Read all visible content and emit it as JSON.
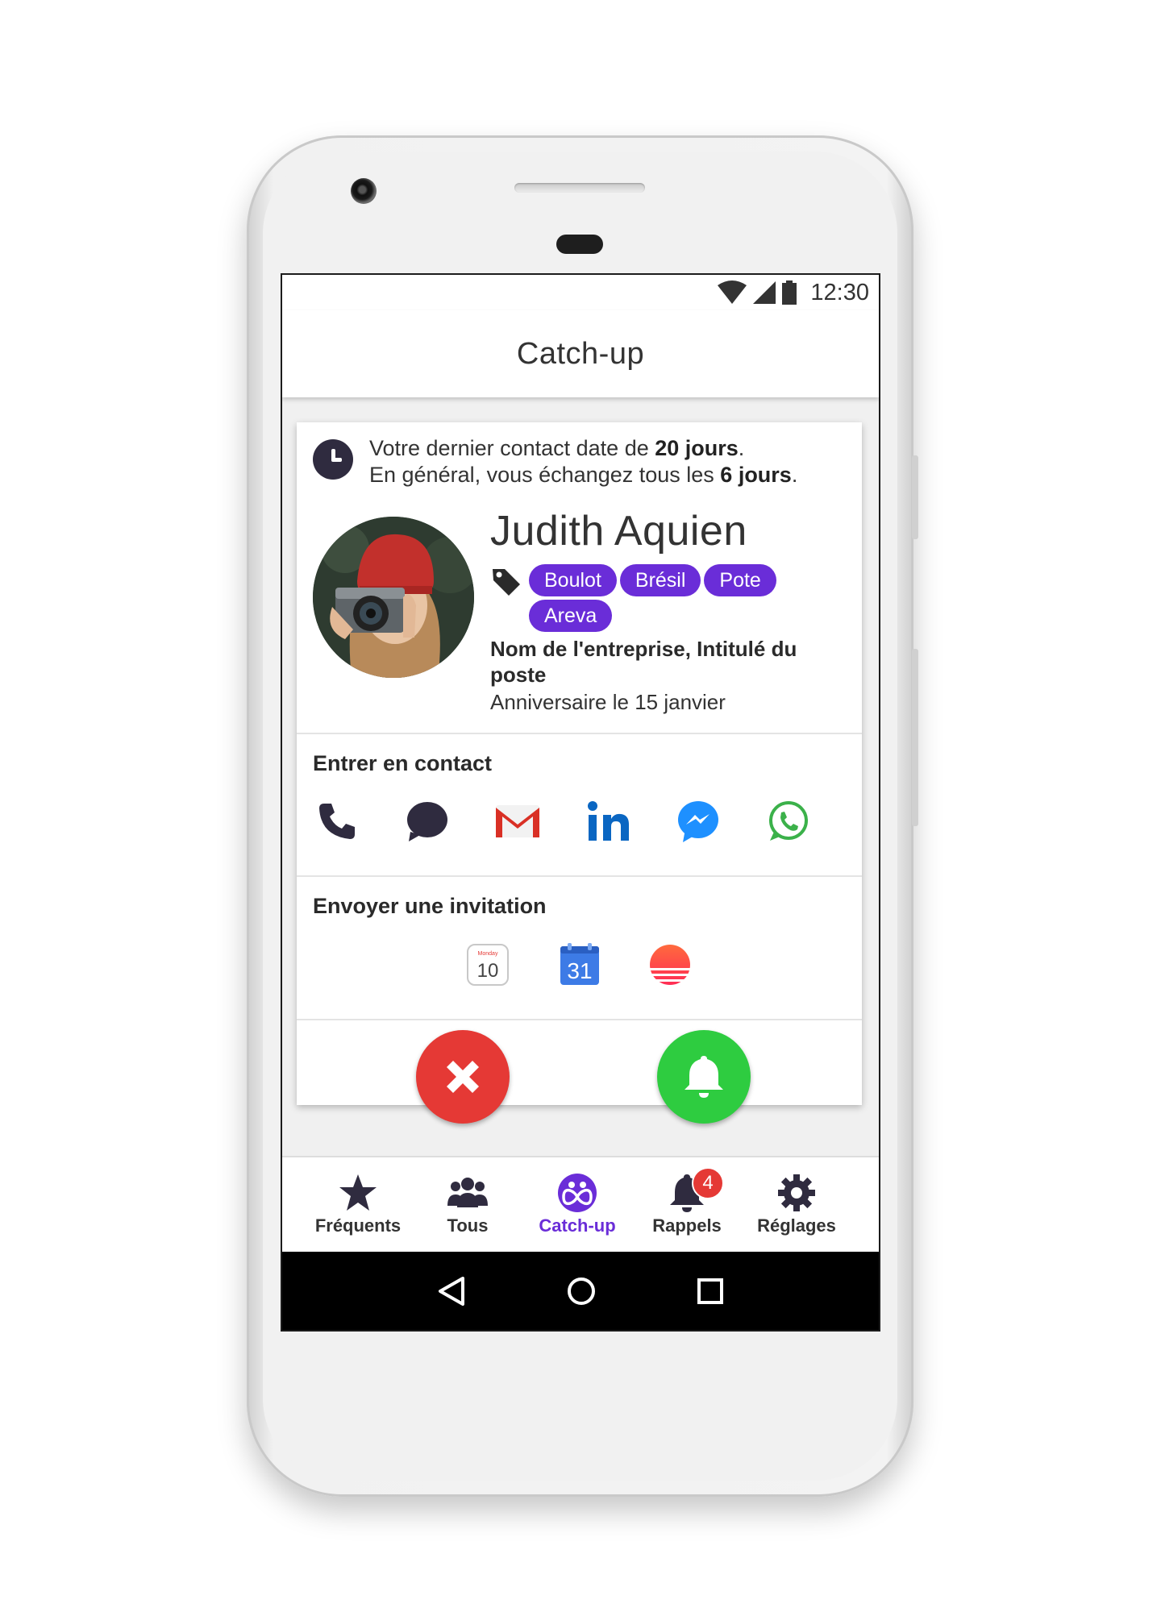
{
  "status_bar": {
    "time": "12:30"
  },
  "app_bar": {
    "title": "Catch-up"
  },
  "card": {
    "last_contact_prefix": "Votre dernier contact date de ",
    "last_contact_value": "20 jours",
    "last_contact_suffix": ".",
    "usual_prefix": "En général, vous échangez tous les ",
    "usual_value": "6 jours",
    "usual_suffix": ".",
    "contact": {
      "name": "Judith Aquien",
      "tags": [
        "Boulot",
        "Brésil",
        "Pote",
        "Areva"
      ],
      "company_line": "Nom de l'entreprise, Intitulé du poste",
      "birthday": "Anniversaire le 15 janvier"
    },
    "contact_section": {
      "title": "Entrer en contact",
      "channels": [
        "phone-icon",
        "sms-icon",
        "gmail-icon",
        "linkedin-icon",
        "messenger-icon",
        "whatsapp-icon"
      ]
    },
    "invite_section": {
      "title": "Envoyer une invitation",
      "apple_calendar": {
        "weekday": "Monday",
        "day": "10"
      },
      "google_calendar": {
        "day": "31"
      },
      "apps": [
        "apple-calendar-icon",
        "google-calendar-icon",
        "sunrise-calendar-icon"
      ]
    },
    "actions": [
      "dismiss",
      "remind"
    ]
  },
  "bottom_nav": {
    "items": [
      {
        "label": "Fréquents",
        "icon": "star-icon"
      },
      {
        "label": "Tous",
        "icon": "people-icon"
      },
      {
        "label": "Catch-up",
        "icon": "catchup-icon"
      },
      {
        "label": "Rappels",
        "icon": "bell-icon",
        "badge": "4"
      },
      {
        "label": "Réglages",
        "icon": "gear-icon"
      }
    ],
    "active": "Catch-up"
  },
  "colors": {
    "accent": "#6a2dd8",
    "dismiss": "#e53935",
    "remind": "#2ecc40",
    "badge": "#e53935"
  }
}
